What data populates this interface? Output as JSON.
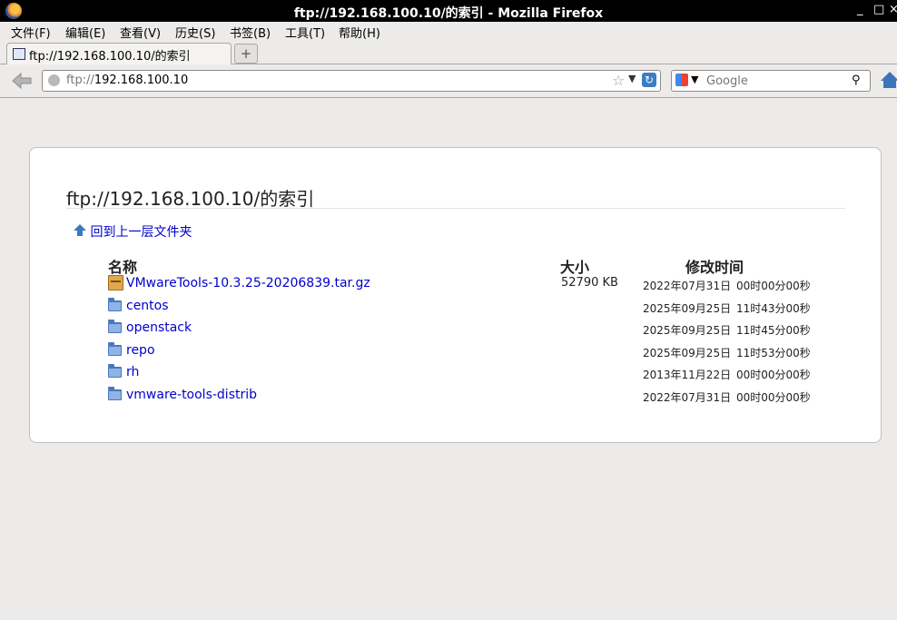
{
  "window": {
    "title": "ftp://192.168.100.10/的索引 - Mozilla Firefox",
    "controls": {
      "minimize": "_",
      "maximize": "□",
      "close": "×"
    }
  },
  "menubar": {
    "items": [
      {
        "label": "文件(F)"
      },
      {
        "label": "编辑(E)"
      },
      {
        "label": "查看(V)"
      },
      {
        "label": "历史(S)"
      },
      {
        "label": "书签(B)"
      },
      {
        "label": "工具(T)"
      },
      {
        "label": "帮助(H)"
      }
    ]
  },
  "tabs": [
    {
      "label": "ftp://192.168.100.10/的索引"
    }
  ],
  "newtab": {
    "symbol": "+"
  },
  "navbar": {
    "url_protocol": "ftp://",
    "url_host": "192.168.100.10",
    "search_placeholder": "Google"
  },
  "page": {
    "heading": "ftp://192.168.100.10/的索引",
    "up_link": "回到上一层文件夹",
    "columns": {
      "name": "名称",
      "size": "大小",
      "modified": "修改时间"
    },
    "rows": [
      {
        "name": "VMwareTools-10.3.25-20206839.tar.gz",
        "type": "file",
        "size": "52790 KB",
        "date": "2022年07月31日",
        "time": "00时00分00秒"
      },
      {
        "name": "centos",
        "type": "folder",
        "size": "",
        "date": "2025年09月25日",
        "time": "11时43分00秒"
      },
      {
        "name": "openstack",
        "type": "folder",
        "size": "",
        "date": "2025年09月25日",
        "time": "11时45分00秒"
      },
      {
        "name": "repo",
        "type": "folder",
        "size": "",
        "date": "2025年09月25日",
        "time": "11时53分00秒"
      },
      {
        "name": "rh",
        "type": "folder",
        "size": "",
        "date": "2013年11月22日",
        "time": "00时00分00秒"
      },
      {
        "name": "vmware-tools-distrib",
        "type": "folder",
        "size": "",
        "date": "2022年07月31日",
        "time": "00时00分00秒"
      }
    ]
  },
  "colors": {
    "link": "#0000cc",
    "folder": "#4a78bd",
    "titlebar": "#000000"
  }
}
